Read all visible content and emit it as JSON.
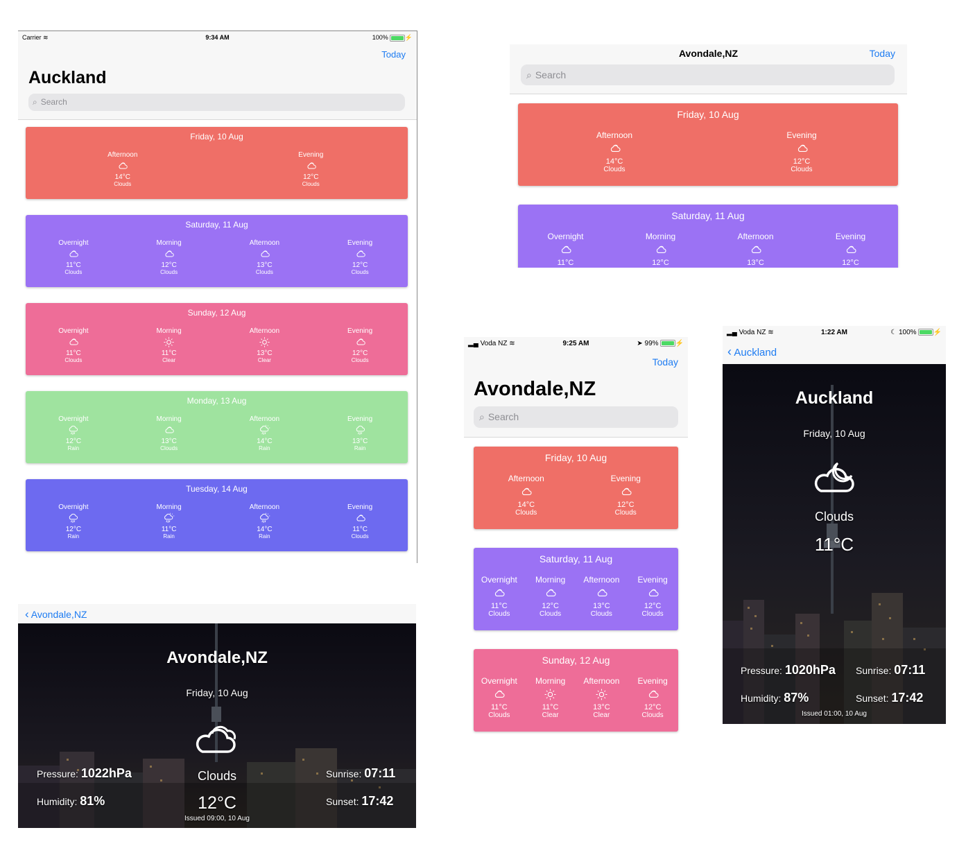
{
  "colors": {
    "friday": "#ef6f67",
    "saturday": "#9b72f4",
    "sunday": "#ee6d98",
    "monday": "#9fe39f",
    "tuesday": "#6d6af0",
    "accent": "#1e7cf2"
  },
  "screen1": {
    "status": {
      "carrier": "Carrier",
      "time": "9:34 AM",
      "battery": "100%"
    },
    "today_button": "Today",
    "title": "Auckland",
    "search_placeholder": "Search",
    "days": [
      {
        "date": "Friday, 10 Aug",
        "periods": [
          {
            "name": "Afternoon",
            "icon": "clouds-icon",
            "temp": "14°C",
            "desc": "Clouds"
          },
          {
            "name": "Evening",
            "icon": "clouds-icon",
            "temp": "12°C",
            "desc": "Clouds"
          }
        ]
      },
      {
        "date": "Saturday, 11 Aug",
        "periods": [
          {
            "name": "Overnight",
            "icon": "clouds-icon",
            "temp": "11°C",
            "desc": "Clouds"
          },
          {
            "name": "Morning",
            "icon": "clouds-icon",
            "temp": "12°C",
            "desc": "Clouds"
          },
          {
            "name": "Afternoon",
            "icon": "clouds-icon",
            "temp": "13°C",
            "desc": "Clouds"
          },
          {
            "name": "Evening",
            "icon": "clouds-icon",
            "temp": "12°C",
            "desc": "Clouds"
          }
        ]
      },
      {
        "date": "Sunday, 12 Aug",
        "periods": [
          {
            "name": "Overnight",
            "icon": "clouds-icon",
            "temp": "11°C",
            "desc": "Clouds"
          },
          {
            "name": "Morning",
            "icon": "sun-icon",
            "temp": "11°C",
            "desc": "Clear"
          },
          {
            "name": "Afternoon",
            "icon": "sun-icon",
            "temp": "13°C",
            "desc": "Clear"
          },
          {
            "name": "Evening",
            "icon": "clouds-icon",
            "temp": "12°C",
            "desc": "Clouds"
          }
        ]
      },
      {
        "date": "Monday, 13 Aug",
        "periods": [
          {
            "name": "Overnight",
            "icon": "rain-icon",
            "temp": "12°C",
            "desc": "Rain"
          },
          {
            "name": "Morning",
            "icon": "clouds-icon",
            "temp": "13°C",
            "desc": "Clouds"
          },
          {
            "name": "Afternoon",
            "icon": "sun-rain-icon",
            "temp": "14°C",
            "desc": "Rain"
          },
          {
            "name": "Evening",
            "icon": "rain-icon",
            "temp": "13°C",
            "desc": "Rain"
          }
        ]
      },
      {
        "date": "Tuesday, 14 Aug",
        "periods": [
          {
            "name": "Overnight",
            "icon": "rain-icon",
            "temp": "12°C",
            "desc": "Rain"
          },
          {
            "name": "Morning",
            "icon": "sun-rain-icon",
            "temp": "11°C",
            "desc": "Rain"
          },
          {
            "name": "Afternoon",
            "icon": "sun-rain-icon",
            "temp": "14°C",
            "desc": "Rain"
          },
          {
            "name": "Evening",
            "icon": "clouds-icon",
            "temp": "11°C",
            "desc": "Clouds"
          }
        ]
      }
    ]
  },
  "screen2": {
    "nav_title": "Avondale,NZ",
    "today_button": "Today",
    "search_placeholder": "Search",
    "days": [
      {
        "date": "Friday, 10 Aug",
        "periods": [
          {
            "name": "Afternoon",
            "icon": "clouds-icon",
            "temp": "14°C",
            "desc": "Clouds"
          },
          {
            "name": "Evening",
            "icon": "clouds-icon",
            "temp": "12°C",
            "desc": "Clouds"
          }
        ]
      },
      {
        "date": "Saturday, 11 Aug",
        "periods": [
          {
            "name": "Overnight",
            "icon": "clouds-icon",
            "temp": "11°C",
            "desc": ""
          },
          {
            "name": "Morning",
            "icon": "clouds-icon",
            "temp": "12°C",
            "desc": ""
          },
          {
            "name": "Afternoon",
            "icon": "clouds-icon",
            "temp": "13°C",
            "desc": ""
          },
          {
            "name": "Evening",
            "icon": "clouds-icon",
            "temp": "12°C",
            "desc": ""
          }
        ]
      }
    ]
  },
  "screen3": {
    "status": {
      "carrier": "Voda NZ",
      "time": "9:25 AM",
      "battery": "99%"
    },
    "today_button": "Today",
    "title": "Avondale,NZ",
    "search_placeholder": "Search",
    "days": [
      {
        "date": "Friday, 10 Aug",
        "periods": [
          {
            "name": "Afternoon",
            "icon": "clouds-icon",
            "temp": "14°C",
            "desc": "Clouds"
          },
          {
            "name": "Evening",
            "icon": "clouds-icon",
            "temp": "12°C",
            "desc": "Clouds"
          }
        ]
      },
      {
        "date": "Saturday, 11 Aug",
        "periods": [
          {
            "name": "Overnight",
            "icon": "clouds-icon",
            "temp": "11°C",
            "desc": "Clouds"
          },
          {
            "name": "Morning",
            "icon": "clouds-icon",
            "temp": "12°C",
            "desc": "Clouds"
          },
          {
            "name": "Afternoon",
            "icon": "clouds-icon",
            "temp": "13°C",
            "desc": "Clouds"
          },
          {
            "name": "Evening",
            "icon": "clouds-icon",
            "temp": "12°C",
            "desc": "Clouds"
          }
        ]
      },
      {
        "date": "Sunday, 12 Aug",
        "periods": [
          {
            "name": "Overnight",
            "icon": "clouds-icon",
            "temp": "11°C",
            "desc": "Clouds"
          },
          {
            "name": "Morning",
            "icon": "sun-icon",
            "temp": "11°C",
            "desc": "Clear"
          },
          {
            "name": "Afternoon",
            "icon": "sun-icon",
            "temp": "13°C",
            "desc": "Clear"
          },
          {
            "name": "Evening",
            "icon": "clouds-icon",
            "temp": "12°C",
            "desc": "Clouds"
          }
        ]
      }
    ]
  },
  "screen4": {
    "status": {
      "carrier": "Voda NZ",
      "time": "1:22 AM",
      "battery": "100%"
    },
    "back_label": "Auckland",
    "city": "Auckland",
    "date": "Friday, 10 Aug",
    "icon": "partly-cloudy-night-icon",
    "condition": "Clouds",
    "temp": "11°C",
    "pressure_label": "Pressure:",
    "pressure": "1020hPa",
    "humidity_label": "Humidity:",
    "humidity": "87%",
    "sunrise_label": "Sunrise:",
    "sunrise": "07:11",
    "sunset_label": "Sunset:",
    "sunset": "17:42",
    "issued": "Issued 01:00, 10 Aug"
  },
  "screen5": {
    "back_label": "Avondale,NZ",
    "city": "Avondale,NZ",
    "date": "Friday, 10 Aug",
    "icon": "clouds-icon",
    "condition": "Clouds",
    "temp": "12°C",
    "pressure_label": "Pressure:",
    "pressure": "1022hPa",
    "humidity_label": "Humidity:",
    "humidity": "81%",
    "sunrise_label": "Sunrise:",
    "sunrise": "07:11",
    "sunset_label": "Sunset:",
    "sunset": "17:42",
    "issued": "Issued 09:00, 10 Aug"
  }
}
